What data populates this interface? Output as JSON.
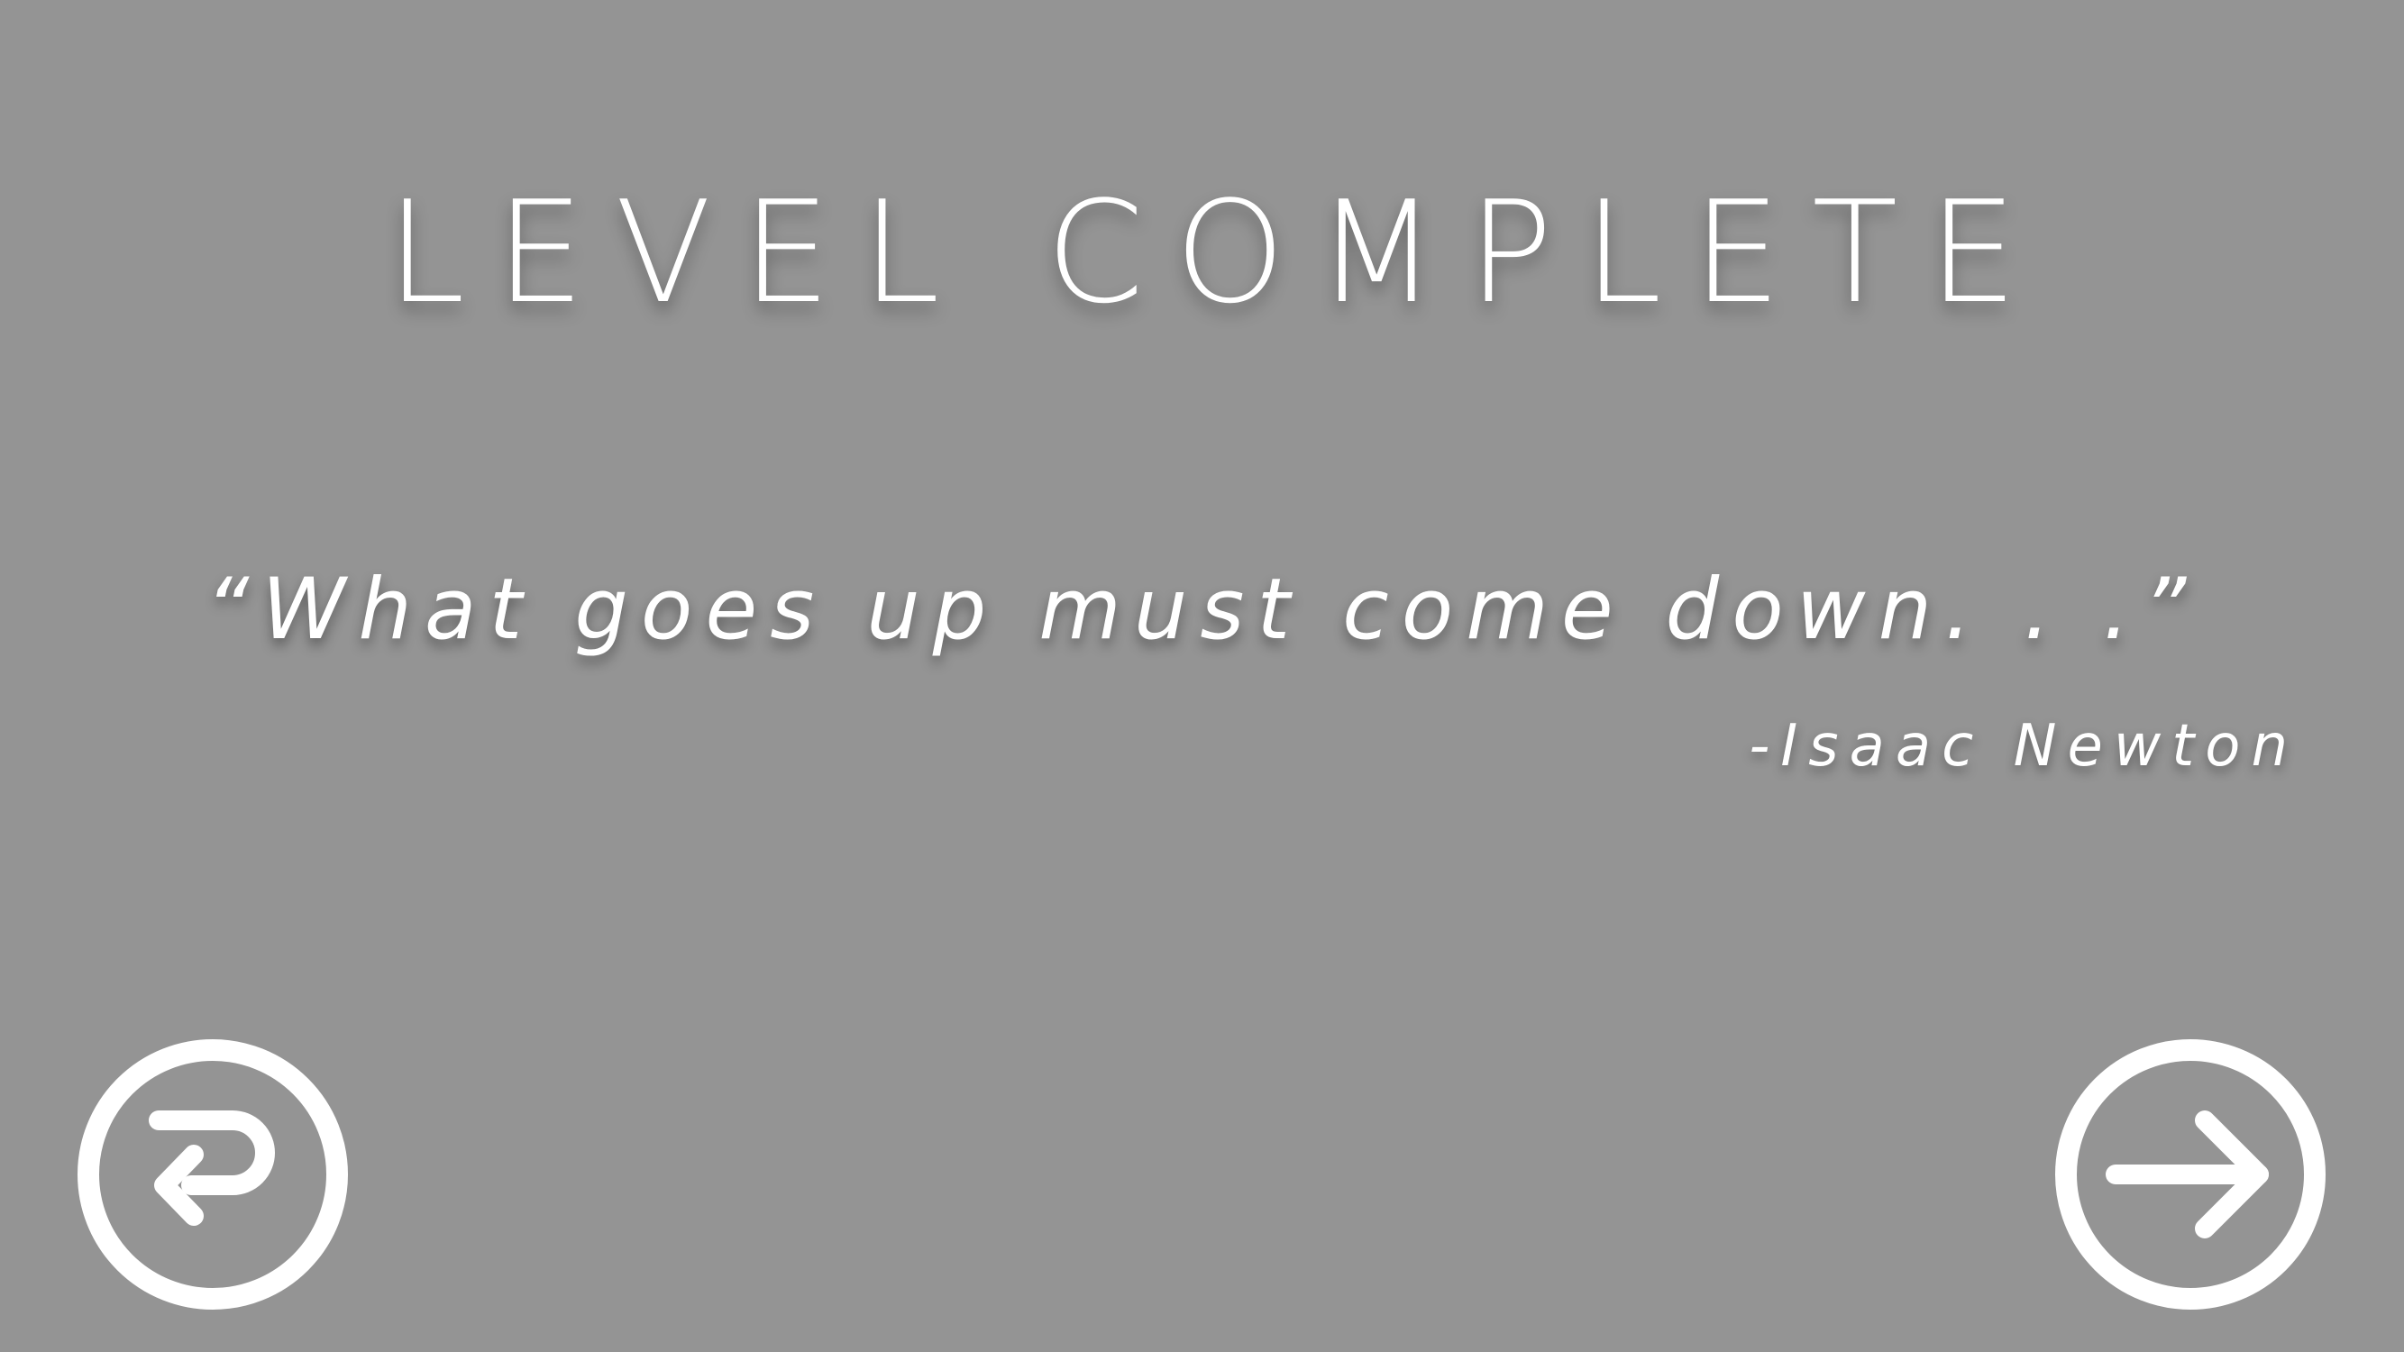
{
  "screen": {
    "title": "LEVEL COMPLETE",
    "quote": "“What goes up must come down. . .”",
    "author": "-Isaac Newton"
  },
  "buttons": {
    "restart_icon": "restart-icon",
    "next_icon": "arrow-right-icon"
  },
  "colors": {
    "background": "#949494",
    "foreground": "#ffffff"
  }
}
